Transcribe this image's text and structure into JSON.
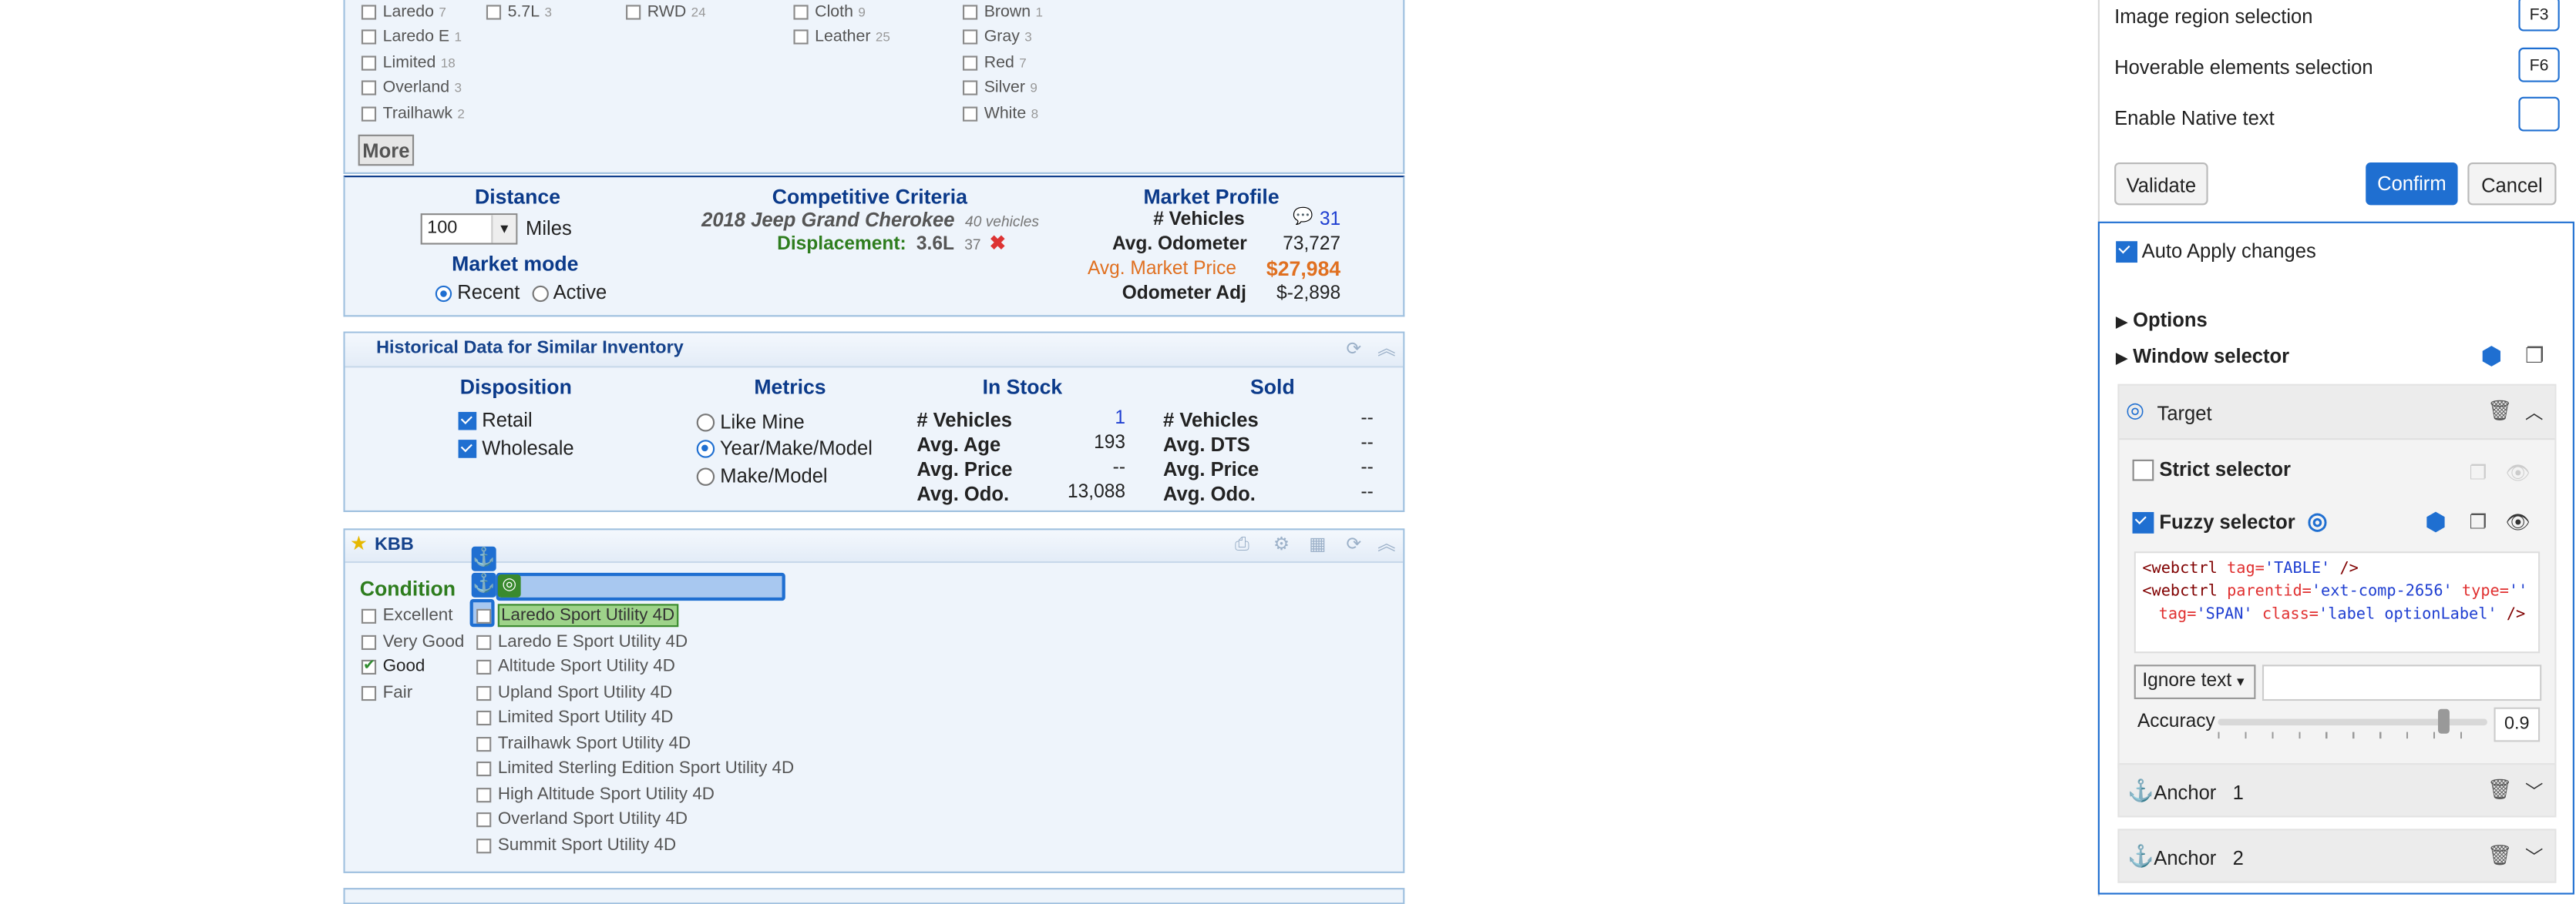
{
  "filters": {
    "trim": [
      {
        "label": "Laredo",
        "count": "7"
      },
      {
        "label": "Laredo E",
        "count": "1"
      },
      {
        "label": "Limited",
        "count": "18"
      },
      {
        "label": "Overland",
        "count": "3"
      },
      {
        "label": "Trailhawk",
        "count": "2"
      }
    ],
    "engine": [
      {
        "label": "5.7L",
        "count": "3"
      }
    ],
    "drive": [
      {
        "label": "RWD",
        "count": "24"
      }
    ],
    "interior": [
      {
        "label": "Cloth",
        "count": "9"
      },
      {
        "label": "Leather",
        "count": "25"
      }
    ],
    "color": [
      {
        "label": "Brown",
        "count": "1"
      },
      {
        "label": "Gray",
        "count": "3"
      },
      {
        "label": "Red",
        "count": "7"
      },
      {
        "label": "Silver",
        "count": "9"
      },
      {
        "label": "White",
        "count": "8"
      }
    ],
    "more_label": "More"
  },
  "market": {
    "distance_title": "Distance",
    "distance_value": "100",
    "distance_unit": "Miles",
    "mode_title": "Market mode",
    "mode_recent": "Recent",
    "mode_active": "Active",
    "criteria_title": "Competitive Criteria",
    "criteria_vehicle": "2018 Jeep Grand Cherokee",
    "criteria_count": "40 vehicles",
    "displacement_label": "Displacement:",
    "displacement_value": "3.6L",
    "displacement_count": "37",
    "profile_title": "Market Profile",
    "vehicles_label": "# Vehicles",
    "vehicles_value": "31",
    "odometer_label": "Avg. Odometer",
    "odometer_value": "73,727",
    "price_label": "Avg. Market Price",
    "price_value": "$27,984",
    "odoadj_label": "Odometer Adj",
    "odoadj_value": "$-2,898"
  },
  "historical": {
    "title": "Historical Data for Similar Inventory",
    "disposition_title": "Disposition",
    "retail": "Retail",
    "wholesale": "Wholesale",
    "metrics_title": "Metrics",
    "like_mine": "Like Mine",
    "ymm": "Year/Make/Model",
    "mm": "Make/Model",
    "instock_title": "In Stock",
    "sold_title": "Sold",
    "instock": [
      {
        "label": "# Vehicles",
        "value": "1"
      },
      {
        "label": "Avg. Age",
        "value": "193"
      },
      {
        "label": "Avg. Price",
        "value": "--"
      },
      {
        "label": "Avg. Odo.",
        "value": "13,088"
      }
    ],
    "sold": [
      {
        "label": "# Vehicles",
        "value": "--"
      },
      {
        "label": "Avg. DTS",
        "value": "--"
      },
      {
        "label": "Avg. Price",
        "value": "--"
      },
      {
        "label": "Avg. Odo.",
        "value": "--"
      }
    ]
  },
  "kbb": {
    "title": "KBB",
    "condition_title": "Condition",
    "conditions": [
      "Excellent",
      "Very Good",
      "Good",
      "Fair"
    ],
    "trims": [
      "Laredo Sport Utility 4D",
      "Laredo E Sport Utility 4D",
      "Altitude Sport Utility 4D",
      "Upland Sport Utility 4D",
      "Limited Sport Utility 4D",
      "Trailhawk Sport Utility 4D",
      "Limited Sterling Edition Sport Utility 4D",
      "High Altitude Sport Utility 4D",
      "Overland Sport Utility 4D",
      "Summit Sport Utility 4D"
    ]
  },
  "settings": {
    "image_region": "Image region selection",
    "image_region_key": "F3",
    "hoverable": "Hoverable elements selection",
    "hoverable_key": "F6",
    "native_text": "Enable Native text",
    "native_text_key": "",
    "validate": "Validate",
    "confirm": "Confirm",
    "cancel": "Cancel",
    "auto_apply": "Auto Apply changes",
    "options": "Options",
    "window_selector": "Window selector",
    "target": "Target",
    "strict_selector": "Strict selector",
    "fuzzy_selector": "Fuzzy selector",
    "selector_line1_tag": "<webctrl",
    "selector_line1_attr": "tag=",
    "selector_line1_val": "'TABLE'",
    "selector_line1_end": " />",
    "selector_line2_tag": "<webctrl",
    "selector_line2_attr1": "parentid=",
    "selector_line2_val1": "'ext-comp-2656'",
    "selector_line2_attr2": "type=",
    "selector_line2_val2": "''",
    "selector_line3_attr1": "tag=",
    "selector_line3_val1": "'SPAN'",
    "selector_line3_attr2": "class=",
    "selector_line3_val2": "'label optionLabel'",
    "selector_line3_end": " />",
    "ignore_text": "Ignore text",
    "accuracy_label": "Accuracy",
    "accuracy_value": "0.9",
    "anchor1": "Anchor",
    "anchor1_num": "1",
    "anchor2": "Anchor",
    "anchor2_num": "2"
  },
  "colors": {
    "accent": "#1f6fd1",
    "price": "#e07020",
    "green": "#2e7d1e",
    "navy": "#0b3a8a"
  }
}
